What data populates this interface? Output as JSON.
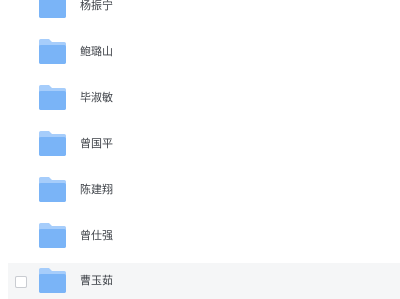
{
  "colors": {
    "folder_light": "#a6cdfb",
    "folder_main": "#7ab4f7",
    "text": "#3b3f45",
    "hover_bg": "#f5f6f7"
  },
  "folders": [
    {
      "name": "杨振宁",
      "icon": "folder-icon"
    },
    {
      "name": "鲍璐山",
      "icon": "folder-icon"
    },
    {
      "name": "毕淑敏",
      "icon": "folder-icon"
    },
    {
      "name": "曾国平",
      "icon": "folder-icon"
    },
    {
      "name": "陈建翔",
      "icon": "folder-icon"
    },
    {
      "name": "曾仕强",
      "icon": "folder-icon"
    },
    {
      "name": "曹玉茹",
      "icon": "folder-icon",
      "hovered": true
    }
  ]
}
